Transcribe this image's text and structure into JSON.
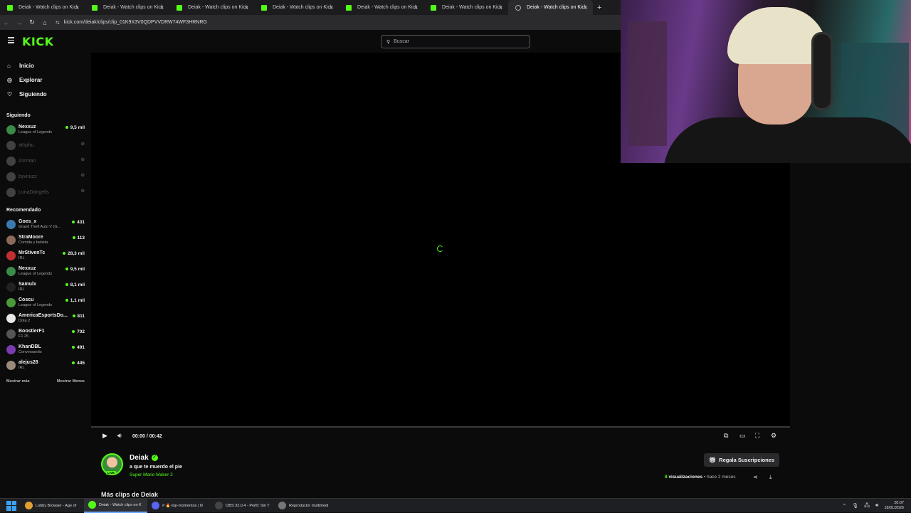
{
  "browser": {
    "tabs": [
      {
        "title": "Deiak - Watch clips on Kick",
        "active": false
      },
      {
        "title": "Deiak - Watch clips on Kick",
        "active": false
      },
      {
        "title": "Deiak - Watch clips on Kick",
        "active": false
      },
      {
        "title": "Deiak - Watch clips on Kick",
        "active": false
      },
      {
        "title": "Deiak - Watch clips on Kick",
        "active": false
      },
      {
        "title": "Deiak - Watch clips on Kick",
        "active": false
      },
      {
        "title": "Deiak - Watch clips on Kick",
        "active": true
      }
    ],
    "new_tab": "+",
    "url": "kick.com/deiak/clips/clip_01K9X3V0QDPVVDRW74WF3HRNRG"
  },
  "site": {
    "logo": "KICK",
    "search_placeholder": "Buscar"
  },
  "sidebar": {
    "nav": [
      {
        "label": "Inicio",
        "icon": "home-icon"
      },
      {
        "label": "Explorar",
        "icon": "compass-icon"
      },
      {
        "label": "Siguiendo",
        "icon": "heart-icon"
      }
    ],
    "following_title": "Siguiendo",
    "following": [
      {
        "name": "Nexxuz",
        "game": "League of Legends",
        "viewers": "9,5 mil",
        "live": true,
        "color": "#3a8a4a"
      },
      {
        "name": "xKiphu",
        "game": "",
        "viewers": "",
        "live": false,
        "color": "#777"
      },
      {
        "name": "Zorman",
        "game": "",
        "viewers": "",
        "live": false,
        "color": "#777"
      },
      {
        "name": "byviruzz",
        "game": "",
        "viewers": "",
        "live": false,
        "color": "#777"
      },
      {
        "name": "LunaDangelis",
        "game": "",
        "viewers": "",
        "live": false,
        "color": "#777"
      }
    ],
    "recommended_title": "Recomendado",
    "recommended": [
      {
        "name": "Goes_x",
        "game": "Grand Theft Auto V (G...",
        "viewers": "431",
        "color": "#3a7ab0"
      },
      {
        "name": "StraMoore",
        "game": "Comida y bebida",
        "viewers": "113",
        "color": "#8a6a5a"
      },
      {
        "name": "MrStivenTc",
        "game": "IRL",
        "viewers": "28,3 mil",
        "color": "#c03030"
      },
      {
        "name": "Nexxuz",
        "game": "League of Legends",
        "viewers": "9,5 mil",
        "color": "#3a8a4a"
      },
      {
        "name": "Samulx",
        "game": "IRL",
        "viewers": "8,1 mil",
        "color": "#222"
      },
      {
        "name": "Coscu",
        "game": "League of Legends",
        "viewers": "1,1 mil",
        "color": "#4a9a3a"
      },
      {
        "name": "AmericaEsportsDo...",
        "game": "Dota 2",
        "viewers": "811",
        "color": "#e8e8e8"
      },
      {
        "name": "BoostierF1",
        "game": "F1 25",
        "viewers": "702",
        "color": "#555"
      },
      {
        "name": "KhanDBL",
        "game": "Conversando",
        "viewers": "491",
        "color": "#7a3ab0"
      },
      {
        "name": "alejus28",
        "game": "IRL",
        "viewers": "445",
        "color": "#9a8a7a"
      }
    ],
    "show_more": "Mostrar más",
    "show_less": "Mostrar Menos"
  },
  "player": {
    "time": "00:00 / 00:42",
    "progress": 0
  },
  "clip": {
    "streamer": "Deiak",
    "live_badge": "LIVE",
    "title": "a que te muerdo el pie",
    "game": "Super Mario Maker 2",
    "subscribe_label": "Regala Suscripciones",
    "views_count": "8",
    "views_label": "visualizaciones",
    "posted": "• hace 2 meses",
    "more_clips": "Más clips de Deiak"
  },
  "taskbar": {
    "apps": [
      {
        "label": "Lobby Browser - Age of",
        "color": "#e0a030",
        "active": false
      },
      {
        "label": "Deiak - Watch clips on K",
        "color": "#53fc18",
        "active": true
      },
      {
        "label": "# 🔥-top-momentos | N",
        "color": "#5865f2",
        "active": false
      },
      {
        "label": "OBS 32.0.4 - Perfil: Sin T",
        "color": "#444",
        "active": false
      },
      {
        "label": "Reproductor multimedi",
        "color": "#777",
        "active": false
      }
    ],
    "time": "20:07",
    "date": "18/01/2026"
  },
  "colors": {
    "brand": "#53fc18",
    "bg": "#0b0b0c"
  }
}
